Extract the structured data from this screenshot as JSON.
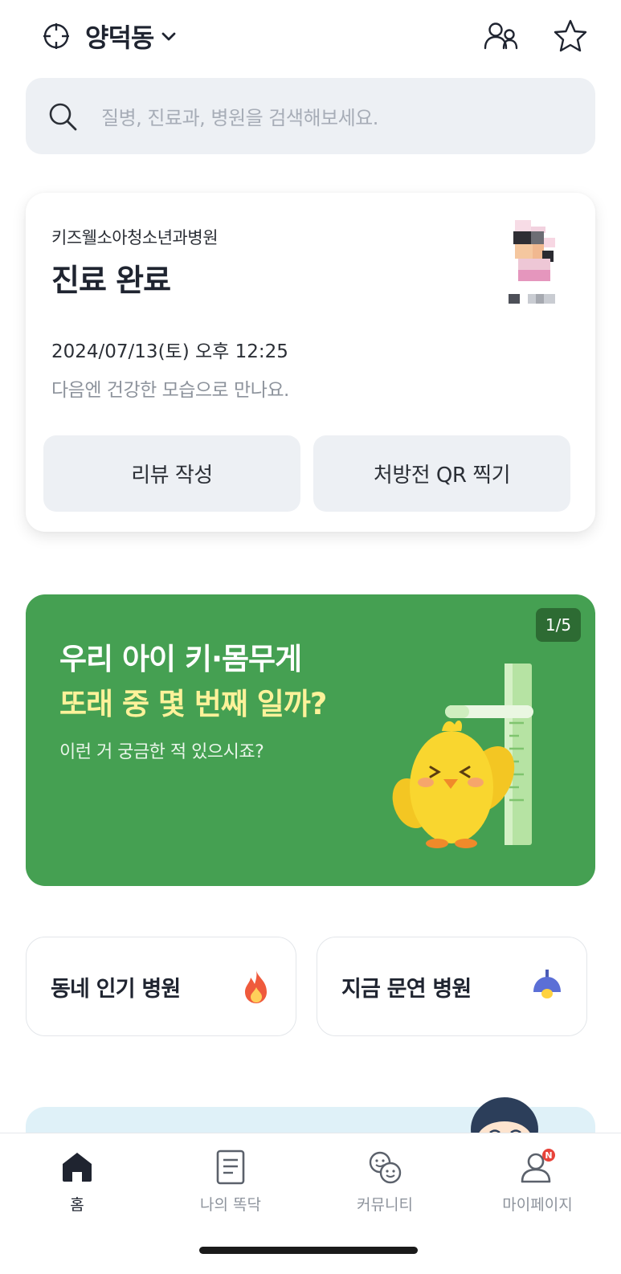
{
  "header": {
    "location": "양덕동",
    "icons": [
      "target-icon",
      "chevron-down-icon",
      "family-icon",
      "star-icon"
    ]
  },
  "search": {
    "placeholder": "질병, 진료과, 병원을 검색해보세요."
  },
  "visit_card": {
    "hospital": "키즈웰소아청소년과병원",
    "status": "진료 완료",
    "datetime": "2024/07/13(토) 오후 12:25",
    "message": "다음엔 건강한 모습으로 만나요.",
    "review_button": "리뷰 작성",
    "qr_button": "처방전 QR 찍기"
  },
  "banner": {
    "line1": "우리 아이 키·몸무게",
    "line2": "또래 중 몇 번째 일까?",
    "line3": "이런 거 궁금한 적 있으시죠?",
    "pager": "1/5",
    "bg_color": "#45a052",
    "highlight_color": "#fdf29a"
  },
  "quick_links": [
    {
      "label": "동네 인기 병원",
      "icon": "fire-icon"
    },
    {
      "label": "지금 문연 병원",
      "icon": "lamp-icon"
    }
  ],
  "bottom_nav": [
    {
      "label": "홈",
      "icon": "home-icon",
      "active": true
    },
    {
      "label": "나의 똑닥",
      "icon": "document-icon",
      "active": false
    },
    {
      "label": "커뮤니티",
      "icon": "community-icon",
      "active": false
    },
    {
      "label": "마이페이지",
      "icon": "profile-icon",
      "active": false,
      "badge": "N"
    }
  ]
}
